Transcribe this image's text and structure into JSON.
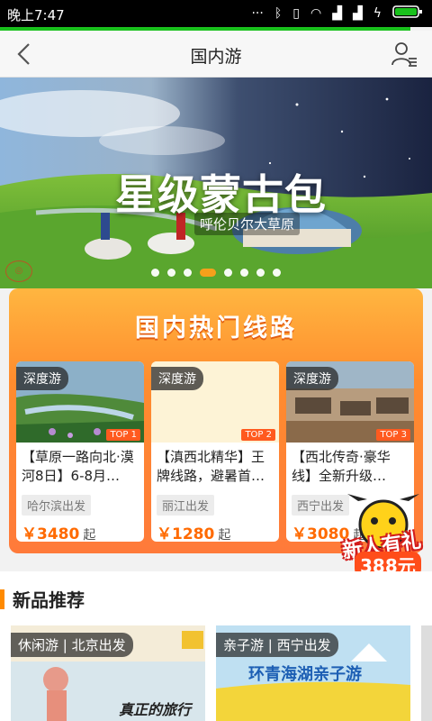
{
  "status_bar": {
    "time": "晚上7:47"
  },
  "nav": {
    "title": "国内游"
  },
  "banner": {
    "headline": "星级蒙古包",
    "subtitle": "呼伦贝尔大草原",
    "slides": 8,
    "active_slide": 4
  },
  "hot_routes": {
    "title": "国内热门线路",
    "cards": [
      {
        "tag": "深度游",
        "rank": "TOP 1",
        "name": "【草原一路向北·漠河8日】6-8月…",
        "from": "哈尔滨出发",
        "price": "￥3480",
        "unit": "起"
      },
      {
        "tag": "深度游",
        "rank": "TOP 2",
        "name": "【滇西北精华】王牌线路，避暑首…",
        "from": "丽江出发",
        "price": "￥1280",
        "unit": "起"
      },
      {
        "tag": "深度游",
        "rank": "TOP 3",
        "name": "【西北传奇·豪华线】全新升级…",
        "from": "西宁出发",
        "price": "￥3080",
        "unit": "起"
      }
    ]
  },
  "promo": {
    "text": "新人有礼",
    "amount": "388元"
  },
  "new_products": {
    "title": "新品推荐",
    "cards": [
      {
        "label": "休闲游 | 北京出发",
        "art_text": "真正的旅行"
      },
      {
        "label": "亲子游 | 西宁出发",
        "art_text": "环青海湖亲子游"
      }
    ]
  },
  "colors": {
    "accent": "#ff8a00",
    "status_green": "#19c11c",
    "price": "#ff6a00"
  }
}
